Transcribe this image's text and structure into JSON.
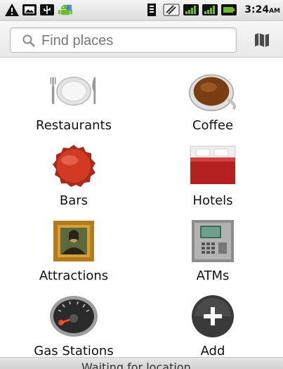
{
  "status_bar": {
    "time": "3:24",
    "ampm": "AM",
    "left_icons": [
      "warning-icon",
      "photo-icon",
      "usb-icon",
      "android-icon"
    ],
    "right_icons": [
      "sd-card-icon",
      "wifi-icon",
      "signal-icon",
      "signal-icon",
      "battery-icon"
    ]
  },
  "search": {
    "placeholder": "Find places",
    "value": "",
    "glass_icon": "search-icon",
    "map_icon": "map-icon"
  },
  "categories": [
    {
      "label": "Restaurants",
      "icon": "plate-icon"
    },
    {
      "label": "Coffee",
      "icon": "coffee-cup-icon"
    },
    {
      "label": "Bars",
      "icon": "bottle-cap-icon"
    },
    {
      "label": "Hotels",
      "icon": "bed-icon"
    },
    {
      "label": "Attractions",
      "icon": "painting-icon"
    },
    {
      "label": "ATMs",
      "icon": "atm-icon"
    },
    {
      "label": "Gas Stations",
      "icon": "gauge-icon"
    },
    {
      "label": "Add",
      "icon": "add-icon"
    }
  ],
  "bottom": {
    "status_text": "Waiting for location..."
  },
  "colors": {
    "accent_green": "#6dbb2b",
    "bottle_cap_red": "#d23a24",
    "bed_red": "#b52020",
    "add_circle": "#3a3a3a"
  }
}
